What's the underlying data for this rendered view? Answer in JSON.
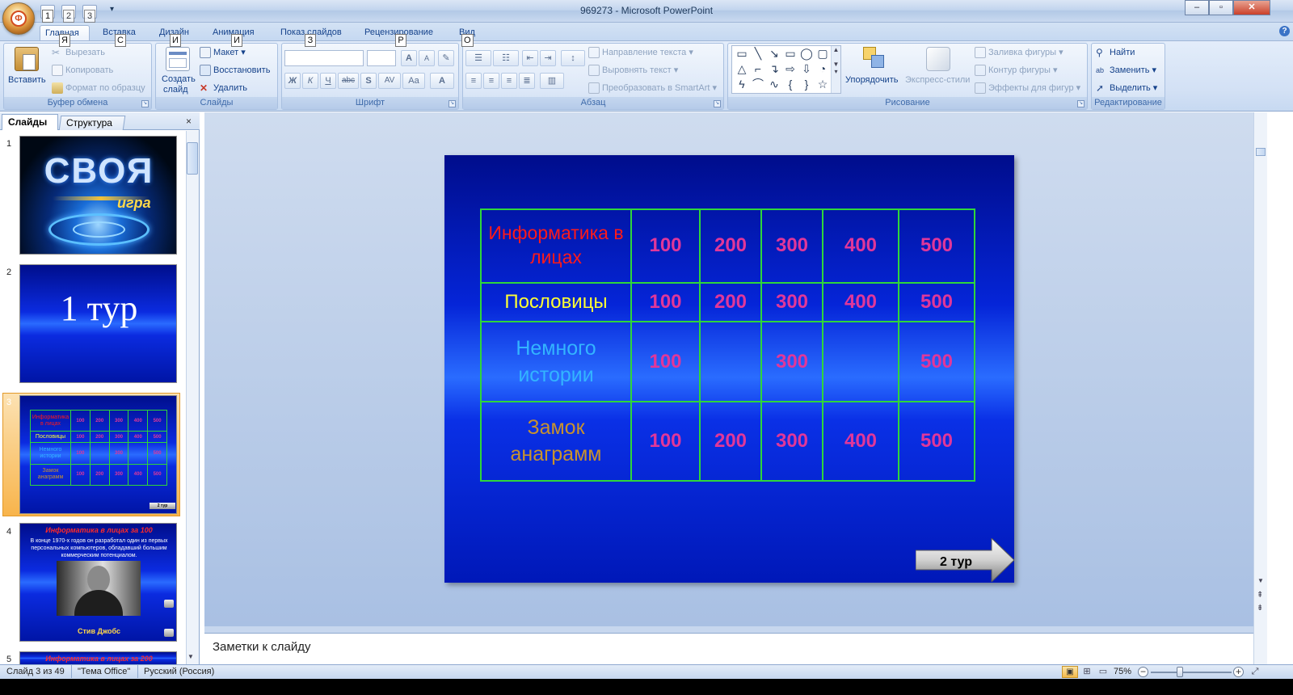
{
  "window": {
    "title": "969273 - Microsoft PowerPoint",
    "minimize": "–",
    "maximize": "▫",
    "close": "✕"
  },
  "quick_access": {
    "items": [
      "1",
      "2",
      "3"
    ],
    "customize": "▾"
  },
  "office_button_letter": "Ф",
  "tabs": [
    {
      "label": "Главная",
      "keytip": "Я"
    },
    {
      "label": "Вставка",
      "keytip": "С"
    },
    {
      "label": "Дизайн",
      "keytip": "И"
    },
    {
      "label": "Анимация",
      "keytip": "И"
    },
    {
      "label": "Показ слайдов",
      "keytip": "З"
    },
    {
      "label": "Рецензирование",
      "keytip": "Р"
    },
    {
      "label": "Вид",
      "keytip": "О"
    }
  ],
  "ribbon": {
    "clipboard": {
      "label": "Буфер обмена",
      "paste": "Вставить",
      "cut": "Вырезать",
      "copy": "Копировать",
      "format_painter": "Формат по образцу"
    },
    "slides": {
      "label": "Слайды",
      "new_slide_line1": "Создать",
      "new_slide_line2": "слайд",
      "layout": "Макет",
      "reset": "Восстановить",
      "delete": "Удалить"
    },
    "font": {
      "label": "Шрифт",
      "bold": "Ж",
      "italic": "К",
      "underline": "Ч",
      "strike": "abc",
      "shadow": "S",
      "spacing": "AV",
      "case": "Aa",
      "color": "A",
      "grow": "A",
      "shrink": "A"
    },
    "paragraph": {
      "label": "Абзац",
      "text_direction": "Направление текста",
      "align_text": "Выровнять текст",
      "smartart": "Преобразовать в SmartArt"
    },
    "drawing": {
      "label": "Рисование",
      "arrange": "Упорядочить",
      "quick_styles": "Экспресс-стили",
      "shape_fill": "Заливка фигуры",
      "shape_outline": "Контур фигуры",
      "shape_effects": "Эффекты для фигур"
    },
    "editing": {
      "label": "Редактирование",
      "find": "Найти",
      "replace": "Заменить",
      "select": "Выделить"
    }
  },
  "left_pane": {
    "tab_slides": "Слайды",
    "tab_outline": "Структура",
    "close": "×",
    "thumbnails": [
      {
        "num": "1",
        "title": "СВОЯ",
        "subtitle": "игра"
      },
      {
        "num": "2",
        "title": "1 тур"
      },
      {
        "num": "3"
      },
      {
        "num": "4",
        "title": "Информатика в лицах за 100",
        "body": "В конце 1970-х годов он разработал один из первых персональных компьютеров, обладавший большим коммерческим потенциалом.",
        "caption": "Стив Джобс"
      },
      {
        "num": "5",
        "title": "Информатика в лицах за 200"
      }
    ]
  },
  "slide": {
    "rows": [
      {
        "category": "Информатика в лицах",
        "color": "#ff1a1a",
        "values": [
          "100",
          "200",
          "300",
          "400",
          "500"
        ]
      },
      {
        "category": "Пословицы",
        "color": "#ffff33",
        "values": [
          "100",
          "200",
          "300",
          "400",
          "500"
        ]
      },
      {
        "category": "Немного истории",
        "color": "#33b4ff",
        "values": [
          "100",
          "",
          "300",
          "",
          "500"
        ]
      },
      {
        "category": "Замок анаграмм",
        "color": "#c8922e",
        "values": [
          "100",
          "200",
          "300",
          "400",
          "500"
        ]
      }
    ],
    "next_button": "2 тур",
    "thumb_next_button": "2 тур"
  },
  "notes_placeholder": "Заметки к слайду",
  "status": {
    "slide_info": "Слайд 3 из 49",
    "theme": "\"Тема Office\"",
    "language": "Русский (Россия)",
    "zoom": "75%",
    "zoom_level": 0.75
  }
}
